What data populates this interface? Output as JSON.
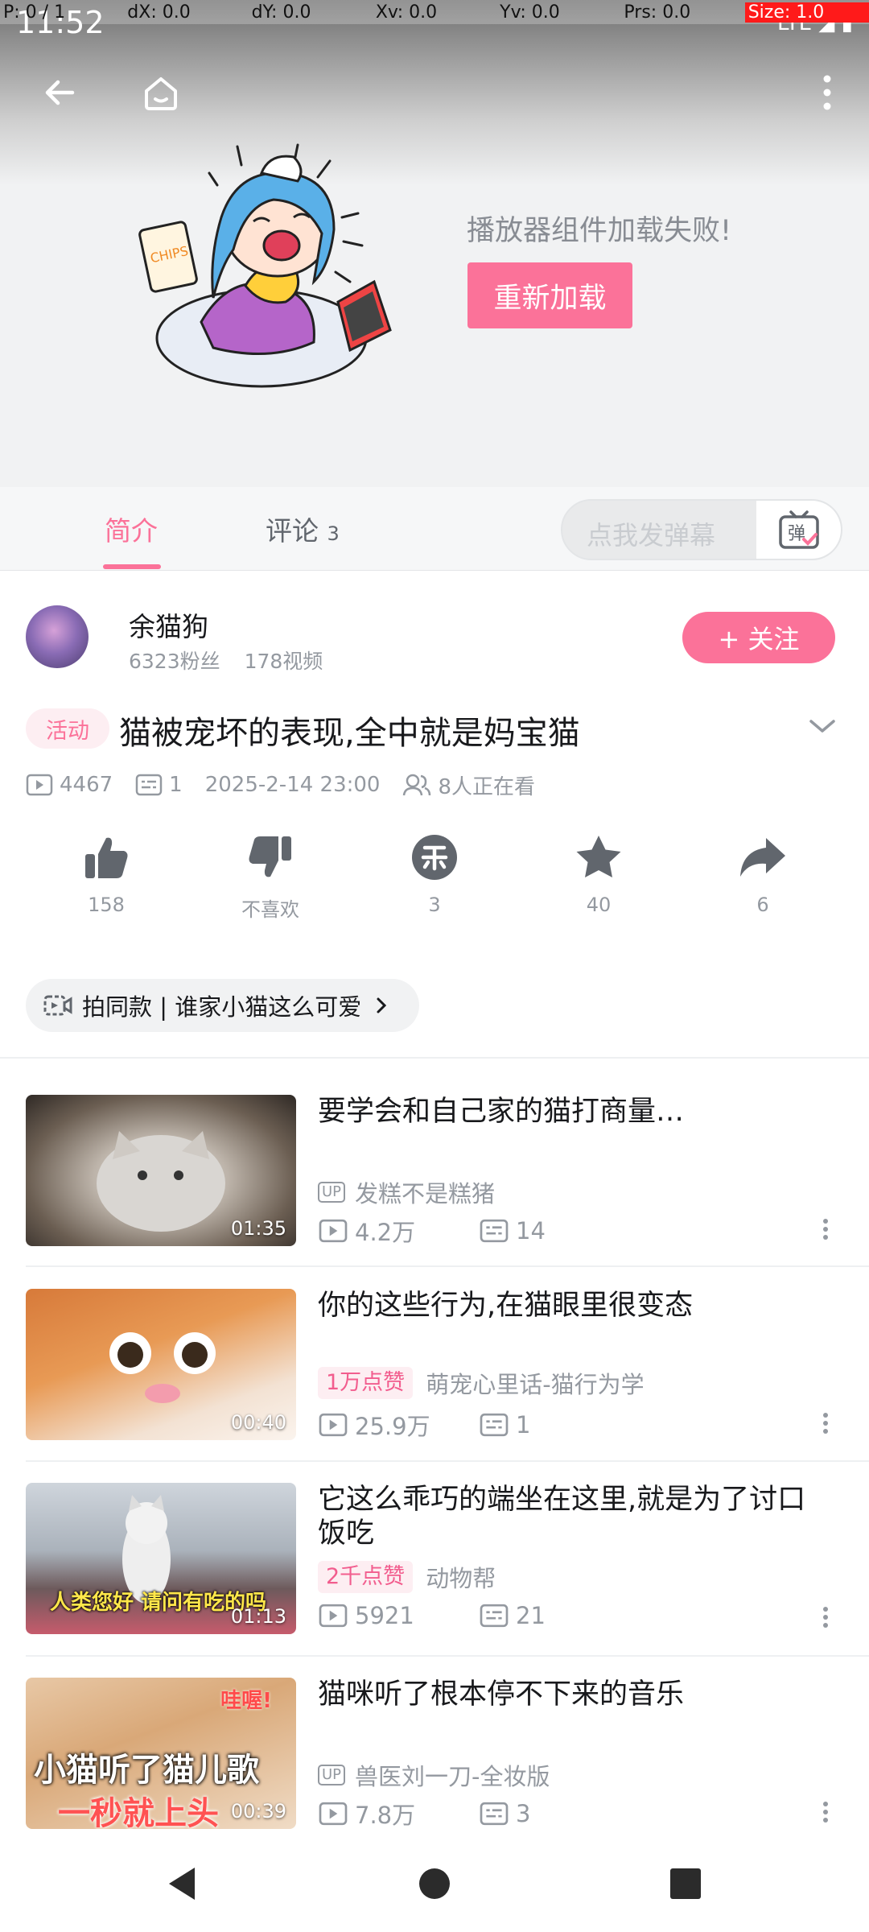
{
  "debug": {
    "p": "P: 0 / 1",
    "dx": "dX: 0.0",
    "dy": "dY: 0.0",
    "xv": "Xv: 0.0",
    "yv": "Yv: 0.0",
    "prs": "Prs: 0.0",
    "size": "Size: 1.0"
  },
  "status_bar": {
    "time": "11:52",
    "network": "LTE"
  },
  "player": {
    "error_text": "播放器组件加载失败!",
    "reload_label": "重新加载",
    "illustration_text": "CHIPS"
  },
  "tabs": [
    {
      "label": "简介"
    },
    {
      "label": "评论",
      "count": "3"
    }
  ],
  "danmaku": {
    "placeholder": "点我发弹幕",
    "toggle_glyph": "弹"
  },
  "author": {
    "name": "余猫狗",
    "fans": "6323粉丝",
    "videos": "178视频",
    "follow_label": "+ 关注"
  },
  "video": {
    "tag": "活动",
    "title": "猫被宠坏的表现,全中就是妈宝猫",
    "plays": "4467",
    "danmaku_count": "1",
    "date": "2025-2-14 23:00",
    "watching": "8人正在看"
  },
  "actions": [
    {
      "icon": "thumb-up-icon",
      "label": "158"
    },
    {
      "icon": "thumb-down-icon",
      "label": "不喜欢"
    },
    {
      "icon": "coin-icon",
      "label": "3"
    },
    {
      "icon": "star-icon",
      "label": "40"
    },
    {
      "icon": "share-icon",
      "label": "6"
    }
  ],
  "pill": {
    "label": "拍同款 | 谁家小猫这么可爱"
  },
  "related": [
    {
      "title": "要学会和自己家的猫打商量…",
      "duration": "01:35",
      "up_badge": "UP",
      "uploader": "发糕不是糕猪",
      "plays": "4.2万",
      "danmaku": "14"
    },
    {
      "title": "你的这些行为,在猫眼里很变态",
      "duration": "00:40",
      "like_badge": "1万点赞",
      "uploader": "萌宠心里话-猫行为学",
      "plays": "25.9万",
      "danmaku": "1"
    },
    {
      "title": "它这么乖巧的端坐在这里,就是为了讨口饭吃",
      "duration": "01:13",
      "like_badge": "2千点赞",
      "uploader": "动物帮",
      "plays": "5921",
      "danmaku": "21",
      "thumb_caption": "人类您好 请问有吃的吗"
    },
    {
      "title": "猫咪听了根本停不下来的音乐",
      "duration": "00:39",
      "up_badge": "UP",
      "uploader": "兽医刘一刀-全妆版",
      "plays": "7.8万",
      "danmaku": "3",
      "thumb_caption_1": "小猫听了猫儿歌",
      "thumb_caption_2": "一秒就上头",
      "thumb_corner": "哇喔!"
    }
  ],
  "colors": {
    "accent": "#fb7299",
    "text": "#18191c",
    "muted": "#9499a0"
  }
}
